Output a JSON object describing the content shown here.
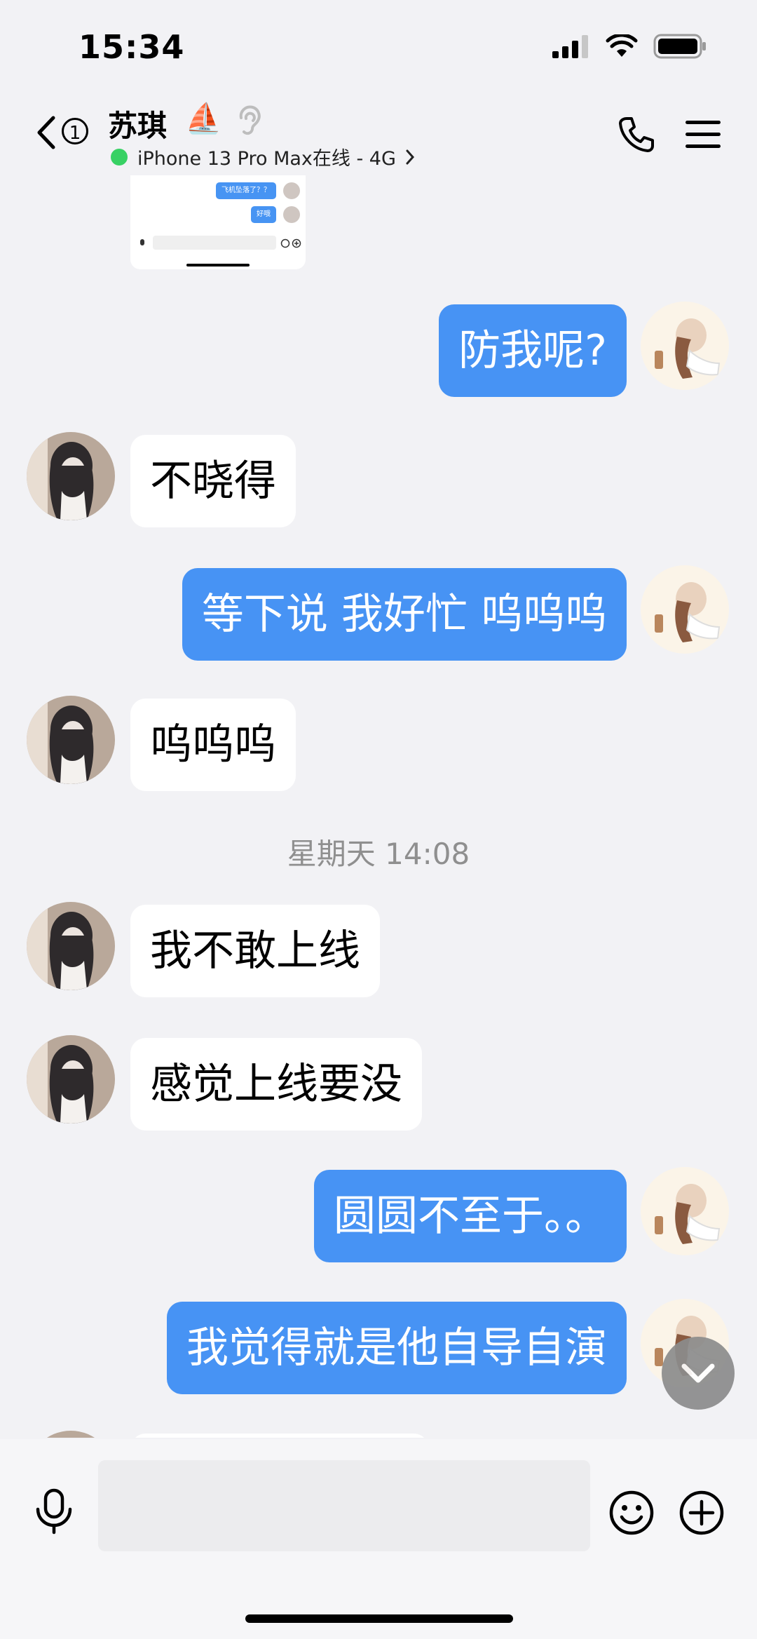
{
  "status_bar": {
    "time": "15:34"
  },
  "header": {
    "back_count": "1",
    "contact_name": "苏琪",
    "contact_emoji": "⛵",
    "presence": "iPhone 13 Pro Max在线 - 4G",
    "presence_color": "#38d164"
  },
  "shared_screenshot": {
    "bubble_1": "飞机坠落了？？",
    "bubble_2": "好哦"
  },
  "messages": [
    {
      "side": "out",
      "text": "防我呢?"
    },
    {
      "side": "in",
      "text": "不晓得"
    },
    {
      "side": "out",
      "text": "等下说 我好忙 呜呜呜"
    },
    {
      "side": "in",
      "text": "呜呜呜"
    },
    {
      "side": "in",
      "text": "我不敢上线"
    },
    {
      "side": "in",
      "text": "感觉上线要没"
    },
    {
      "side": "out",
      "text": "圆圆不至于。。"
    },
    {
      "side": "out",
      "text": "我觉得就是他自导自演"
    }
  ],
  "time_separator": "星期天 14:08",
  "input": {
    "value": "",
    "placeholder": ""
  },
  "colors": {
    "outgoing_bubble": "#4793f4",
    "incoming_bubble": "#ffffff",
    "background": "#f2f2f5"
  },
  "icons": [
    "back-icon",
    "ear-icon",
    "phone-icon",
    "menu-icon",
    "microphone-icon",
    "emoji-icon",
    "plus-icon",
    "chevron-down-icon"
  ]
}
